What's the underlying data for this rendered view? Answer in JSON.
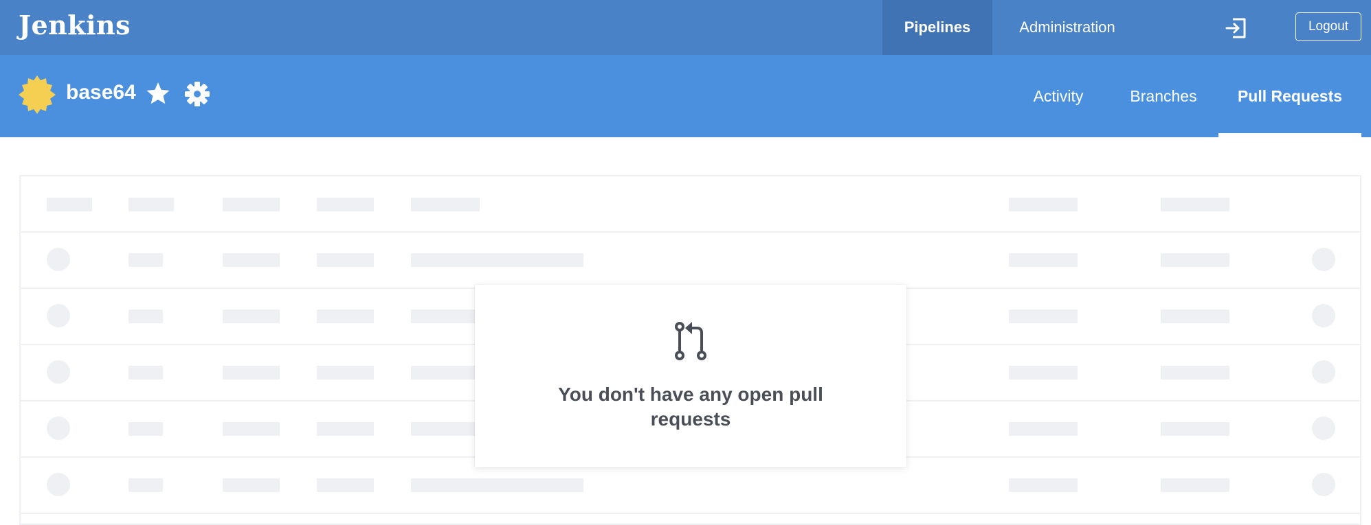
{
  "app": {
    "logo_text": "Jenkins"
  },
  "topnav": {
    "items": [
      {
        "label": "Pipelines",
        "active": true
      },
      {
        "label": "Administration",
        "active": false
      }
    ],
    "signout_icon": "sign-out-arrow-icon",
    "logout_label": "Logout"
  },
  "pipeline": {
    "name": "base64",
    "weather_icon": "sunny-weather-icon",
    "favorite_icon": "star-icon",
    "settings_icon": "gear-icon",
    "tabs": [
      {
        "label": "Activity",
        "active": false
      },
      {
        "label": "Branches",
        "active": false
      },
      {
        "label": "Pull Requests",
        "active": true
      }
    ]
  },
  "empty_state": {
    "icon": "pull-request-icon",
    "message": "You don't have any open pull requests"
  },
  "colors": {
    "topbar": "#4a82c7",
    "topbar_active": "#3f73b4",
    "subheader": "#4a90df",
    "skeleton": "#eef0f4",
    "weather_sun": "#f5cf52",
    "text_dark": "#4a4f57"
  }
}
